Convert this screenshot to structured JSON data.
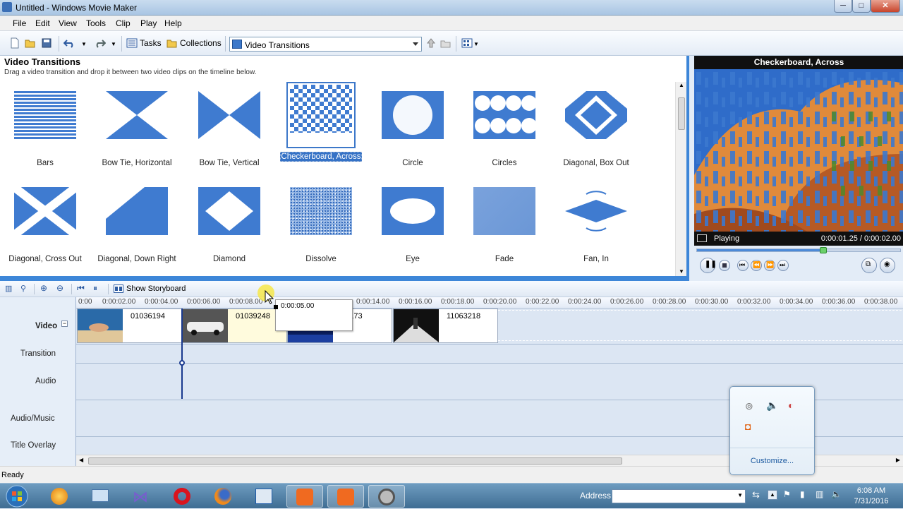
{
  "window": {
    "title": "Untitled - Windows Movie Maker",
    "min_label": "─",
    "max_label": "□",
    "close_label": "✕"
  },
  "menu": [
    "File",
    "Edit",
    "View",
    "Tools",
    "Clip",
    "Play",
    "Help"
  ],
  "toolbar": {
    "tasks_label": "Tasks",
    "collections_label": "Collections",
    "view_select": "Video Transitions"
  },
  "panel": {
    "title": "Video Transitions",
    "subtitle": "Drag a video transition and drop it between two video clips on the timeline below.",
    "tiles": [
      {
        "label": "Bars",
        "selected": false
      },
      {
        "label": "Bow Tie, Horizontal",
        "selected": false
      },
      {
        "label": "Bow Tie, Vertical",
        "selected": false
      },
      {
        "label": "Checkerboard, Across",
        "selected": true
      },
      {
        "label": "Circle",
        "selected": false
      },
      {
        "label": "Circles",
        "selected": false
      },
      {
        "label": "Diagonal, Box Out",
        "selected": false
      },
      {
        "label": "Diagonal, Cross Out",
        "selected": false
      },
      {
        "label": "Diagonal, Down Right",
        "selected": false
      },
      {
        "label": "Diamond",
        "selected": false
      },
      {
        "label": "Dissolve",
        "selected": false
      },
      {
        "label": "Eye",
        "selected": false
      },
      {
        "label": "Fade",
        "selected": false
      },
      {
        "label": "Fan, In",
        "selected": false
      }
    ]
  },
  "preview": {
    "title": "Checkerboard, Across",
    "status": "Playing",
    "time": "0:00:01.25 / 0:00:02.00",
    "progress": 0.62
  },
  "timeline_toolbar": {
    "storyboard_label": "Show Storyboard"
  },
  "timeline": {
    "tracks": [
      "Video",
      "Transition",
      "Audio",
      "Audio/Music",
      "Title Overlay"
    ],
    "ruler": [
      "0:00",
      "0:00:02.00",
      "0:00:04.00",
      "0:00:06.00",
      "0:00:08.00",
      "0:00:14.00",
      "0:00:16.00",
      "0:00:18.00",
      "0:00:20.00",
      "0:00:22.00",
      "0:00:24.00",
      "0:00:26.00",
      "0:00:28.00",
      "0:00:30.00",
      "0:00:32.00",
      "0:00:34.00",
      "0:00:36.00",
      "0:00:38.00"
    ],
    "clips": [
      "01036194",
      "01039248",
      "29173",
      "11063218"
    ],
    "drag_tooltip": "0:00:05.00"
  },
  "status": "Ready",
  "tray_popup": {
    "customize_label": "Customize..."
  },
  "taskbar": {
    "address_label": "Address",
    "time": "6:08 AM",
    "date": "7/31/2016"
  }
}
